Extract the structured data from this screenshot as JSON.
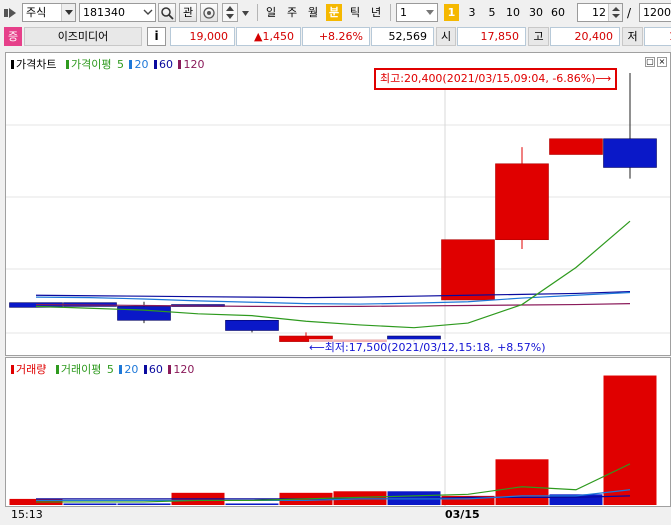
{
  "toolbar": {
    "market": "주식",
    "code": "181340",
    "search_icon": "magnifier-icon",
    "buy_label": "관",
    "period_labels": [
      "일",
      "주",
      "월",
      "분",
      "틱",
      "년"
    ],
    "active_period": "분",
    "interval_value": "1",
    "quick_intervals": [
      "1",
      "3",
      "5",
      "10",
      "30",
      "60"
    ],
    "active_quick": "1",
    "count_value": "12",
    "divider": "/",
    "total_value": "1200"
  },
  "stock": {
    "badge": "증",
    "name": "이즈미디어",
    "info_button": "i",
    "price": "19,000",
    "change": "▲1,450",
    "change_pct": "+8.26%",
    "volume": "52,569",
    "open_label": "시",
    "open": "17,850",
    "high_label": "고",
    "high": "20,400",
    "low_label": "저",
    "low_partial": "1"
  },
  "price_pane": {
    "legend": {
      "title": "가격차트",
      "ma_title": "가격이평",
      "ma_periods": [
        "5",
        "20",
        "60",
        "120"
      ]
    },
    "high_annotation": "최고:20,400(2021/03/15,09:04, -6.86%)⟶",
    "low_annotation": "⟵최저:17,500(2021/03/12,15:18, +8.57%)"
  },
  "volume_pane": {
    "legend": {
      "title": "거래량",
      "ma_title": "거래이평",
      "ma_periods": [
        "5",
        "20",
        "60",
        "120"
      ]
    }
  },
  "xaxis": {
    "left_label": "15:13",
    "date_label": "03/15"
  },
  "colors": {
    "up": "#e00000",
    "down": "#0a18c8",
    "ma5": "#2e9a1e",
    "ma20": "#1e78d8",
    "ma60": "#0a0a9e",
    "ma120": "#8a1a5a",
    "active_period": "#f5b800"
  },
  "chart_data": {
    "type": "candlestick",
    "candles": [
      {
        "dir": "down",
        "open": 17920,
        "close": 17870,
        "high": 17920,
        "low": 17870
      },
      {
        "dir": "down",
        "open": 17920,
        "close": 17880,
        "high": 17920,
        "low": 17880
      },
      {
        "dir": "down",
        "open": 17880,
        "close": 17730,
        "high": 17930,
        "low": 17700
      },
      {
        "dir": "down",
        "open": 17900,
        "close": 17880,
        "high": 17900,
        "low": 17880
      },
      {
        "dir": "down",
        "open": 17730,
        "close": 17620,
        "high": 17730,
        "low": 17600
      },
      {
        "dir": "up",
        "open": 17500,
        "close": 17560,
        "high": 17600,
        "low": 17500
      },
      {
        "dir": "up",
        "open": 17500,
        "close": 17520,
        "high": 17520,
        "low": 17500
      },
      {
        "dir": "down",
        "open": 17560,
        "close": 17520,
        "high": 17560,
        "low": 17500
      },
      {
        "dir": "up",
        "open": 17950,
        "close": 18600,
        "high": 18600,
        "low": 17950
      },
      {
        "dir": "up",
        "open": 18600,
        "close": 19420,
        "high": 19600,
        "low": 18500
      },
      {
        "dir": "up",
        "open": 19520,
        "close": 19690,
        "high": 19690,
        "low": 19520
      },
      {
        "dir": "down",
        "open": 19690,
        "close": 19380,
        "high": 20400,
        "low": 19260
      }
    ],
    "volume": [
      4,
      1,
      1,
      8,
      1,
      8,
      9,
      9,
      6,
      30,
      7,
      85
    ],
    "volume_dir": [
      "up",
      "down",
      "down",
      "up",
      "down",
      "up",
      "up",
      "down",
      "up",
      "up",
      "down",
      "up"
    ],
    "ma5": [
      17880,
      17860,
      17840,
      17800,
      17780,
      17720,
      17680,
      17650,
      17700,
      17900,
      18300,
      18800
    ],
    "ma20": [
      17980,
      17975,
      17960,
      17940,
      17925,
      17910,
      17905,
      17915,
      17930,
      17970,
      18000,
      18030
    ],
    "ma60": [
      18000,
      17995,
      17990,
      17985,
      17980,
      17975,
      17980,
      17990,
      18000,
      18010,
      18020,
      18040
    ],
    "ma120": [
      17900,
      17895,
      17890,
      17885,
      17880,
      17878,
      17880,
      17885,
      17890,
      17895,
      17900,
      17910
    ],
    "vol_ma5": [
      2,
      2,
      2,
      3,
      3,
      4,
      5,
      6,
      7,
      12,
      10,
      27
    ],
    "vol_ma20": [
      3,
      3,
      3,
      3,
      3,
      3,
      4,
      4,
      4,
      6,
      6,
      10
    ],
    "vol_ma60": [
      4,
      4,
      4,
      4,
      4,
      4,
      4,
      4,
      5,
      5,
      5,
      6
    ],
    "price_range": [
      17420,
      20400
    ],
    "volume_range": [
      0,
      86
    ]
  }
}
